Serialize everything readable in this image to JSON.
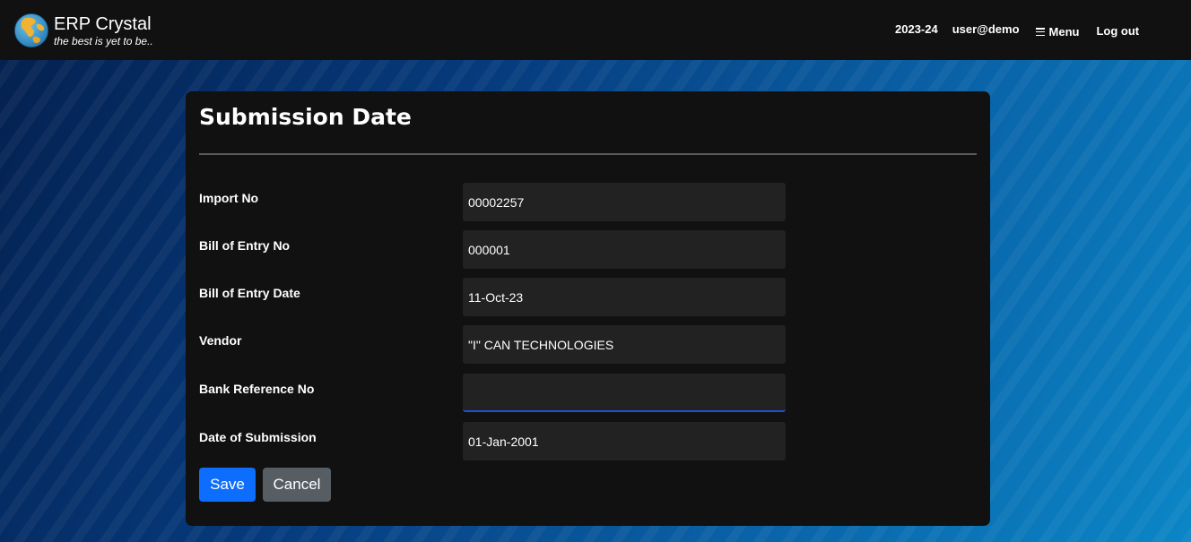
{
  "header": {
    "app_name": "ERP Crystal",
    "tagline": "the best is yet to be..",
    "financial_year": "2023-24",
    "user": "user@demo",
    "menu_label": "Menu",
    "logout_label": "Log out"
  },
  "form": {
    "title": "Submission Date",
    "fields": [
      {
        "label": "Import No",
        "value": "00002257"
      },
      {
        "label": "Bill of Entry No",
        "value": "000001"
      },
      {
        "label": "Bill of Entry Date",
        "value": "11-Oct-23"
      },
      {
        "label": "Vendor",
        "value": "\"I\" CAN TECHNOLOGIES"
      },
      {
        "label": "Bank Reference No",
        "value": ""
      },
      {
        "label": "Date of Submission",
        "value": "01-Jan-2001"
      }
    ],
    "save_label": "Save",
    "cancel_label": "Cancel"
  },
  "icons": {
    "logo": "globe-icon",
    "menu": "hamburger-icon"
  },
  "colors": {
    "topbar": "#111111",
    "card": "#111111",
    "field_bg": "#222222",
    "save_button": "#0d6efd",
    "cancel_button": "#565e64",
    "focus_underline": "#1f4fd6"
  }
}
